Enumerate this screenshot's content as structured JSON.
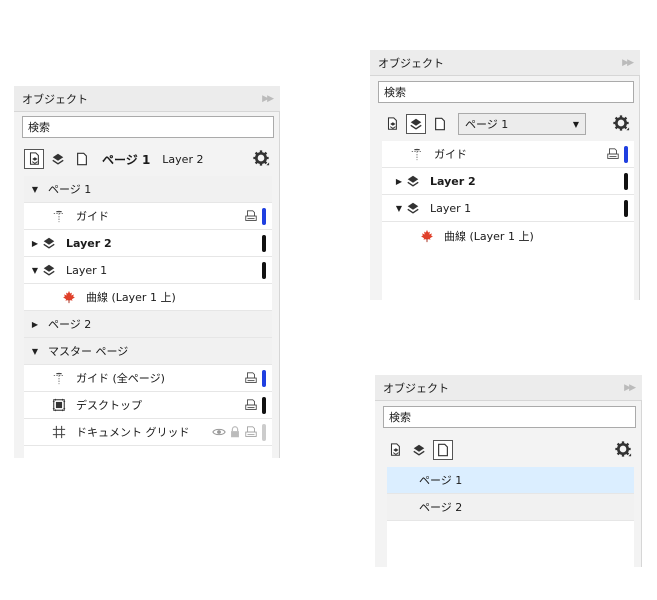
{
  "panel_a": {
    "title": "オブジェクト",
    "search_placeholder": "検索",
    "current_page": "ページ 1",
    "current_layer": "Layer 2",
    "tree": {
      "page1": "ページ 1",
      "guide": "ガイド",
      "layer2": "Layer 2",
      "layer1": "Layer 1",
      "curve": "曲線 (Layer 1  上)",
      "page2": "ページ 2",
      "master": "マスター ページ",
      "guide_all": "ガイド (全ページ)",
      "desktop": "デスクトップ",
      "doc_grid": "ドキュメント グリッド"
    }
  },
  "panel_b": {
    "title": "オブジェクト",
    "search_placeholder": "検索",
    "page_select": "ページ 1",
    "tree": {
      "guide": "ガイド",
      "layer2": "Layer 2",
      "layer1": "Layer 1",
      "curve": "曲線 (Layer 1  上)"
    }
  },
  "panel_c": {
    "title": "オブジェクト",
    "search_placeholder": "検索",
    "pages": [
      "ページ 1",
      "ページ 2"
    ]
  },
  "colors": {
    "guide_bar": "#1f3fe0",
    "layer_bar": "#111111",
    "selection": "#dbeeff",
    "curve_icon": "#e0402a"
  }
}
